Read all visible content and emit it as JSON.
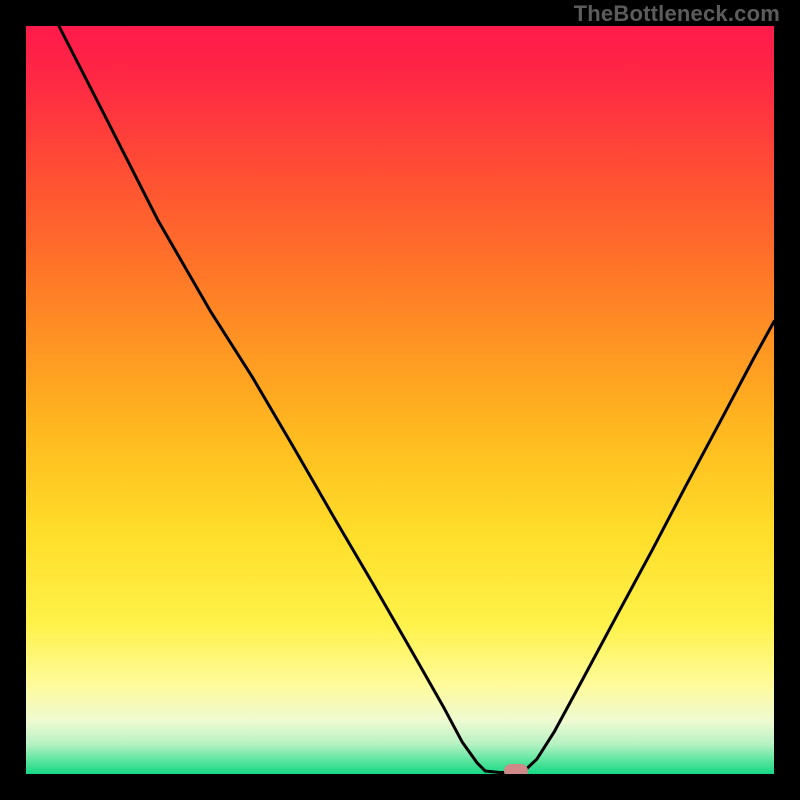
{
  "watermark": "TheBottleneck.com",
  "gradient": {
    "stops": [
      {
        "offset": 0.0,
        "color": "#ff1a4b"
      },
      {
        "offset": 0.08,
        "color": "#ff2a43"
      },
      {
        "offset": 0.18,
        "color": "#ff4a36"
      },
      {
        "offset": 0.3,
        "color": "#ff6d2a"
      },
      {
        "offset": 0.42,
        "color": "#ff9323"
      },
      {
        "offset": 0.55,
        "color": "#ffbb1f"
      },
      {
        "offset": 0.68,
        "color": "#ffde2a"
      },
      {
        "offset": 0.8,
        "color": "#fff24a"
      },
      {
        "offset": 0.88,
        "color": "#fffb9a"
      },
      {
        "offset": 0.93,
        "color": "#eefad2"
      },
      {
        "offset": 0.96,
        "color": "#b6f2c3"
      },
      {
        "offset": 0.985,
        "color": "#4fe39a"
      },
      {
        "offset": 1.0,
        "color": "#17d884"
      }
    ]
  },
  "chart_data": {
    "type": "line",
    "title": "",
    "xlabel": "",
    "ylabel": "",
    "xlim": [
      0,
      100
    ],
    "ylim": [
      0,
      100
    ],
    "series": [
      {
        "name": "bottleneck-curve",
        "points": [
          {
            "x": 4.4,
            "y": 100.0
          },
          {
            "x": 11.0,
            "y": 87.1
          },
          {
            "x": 17.6,
            "y": 74.1
          },
          {
            "x": 24.7,
            "y": 61.8
          },
          {
            "x": 30.3,
            "y": 53.0
          },
          {
            "x": 35.7,
            "y": 43.8
          },
          {
            "x": 41.0,
            "y": 34.6
          },
          {
            "x": 46.4,
            "y": 25.4
          },
          {
            "x": 51.7,
            "y": 16.2
          },
          {
            "x": 55.9,
            "y": 8.8
          },
          {
            "x": 58.3,
            "y": 4.3
          },
          {
            "x": 60.3,
            "y": 1.5
          },
          {
            "x": 61.4,
            "y": 0.4
          },
          {
            "x": 63.3,
            "y": 0.2
          },
          {
            "x": 66.4,
            "y": 0.2
          },
          {
            "x": 68.3,
            "y": 2.0
          },
          {
            "x": 70.6,
            "y": 5.6
          },
          {
            "x": 74.5,
            "y": 12.8
          },
          {
            "x": 79.1,
            "y": 21.4
          },
          {
            "x": 83.7,
            "y": 29.9
          },
          {
            "x": 88.2,
            "y": 38.5
          },
          {
            "x": 92.8,
            "y": 47.1
          },
          {
            "x": 97.3,
            "y": 55.6
          },
          {
            "x": 100.0,
            "y": 60.5
          }
        ]
      }
    ],
    "marker": {
      "x": 65.5,
      "y": 0.4
    }
  }
}
